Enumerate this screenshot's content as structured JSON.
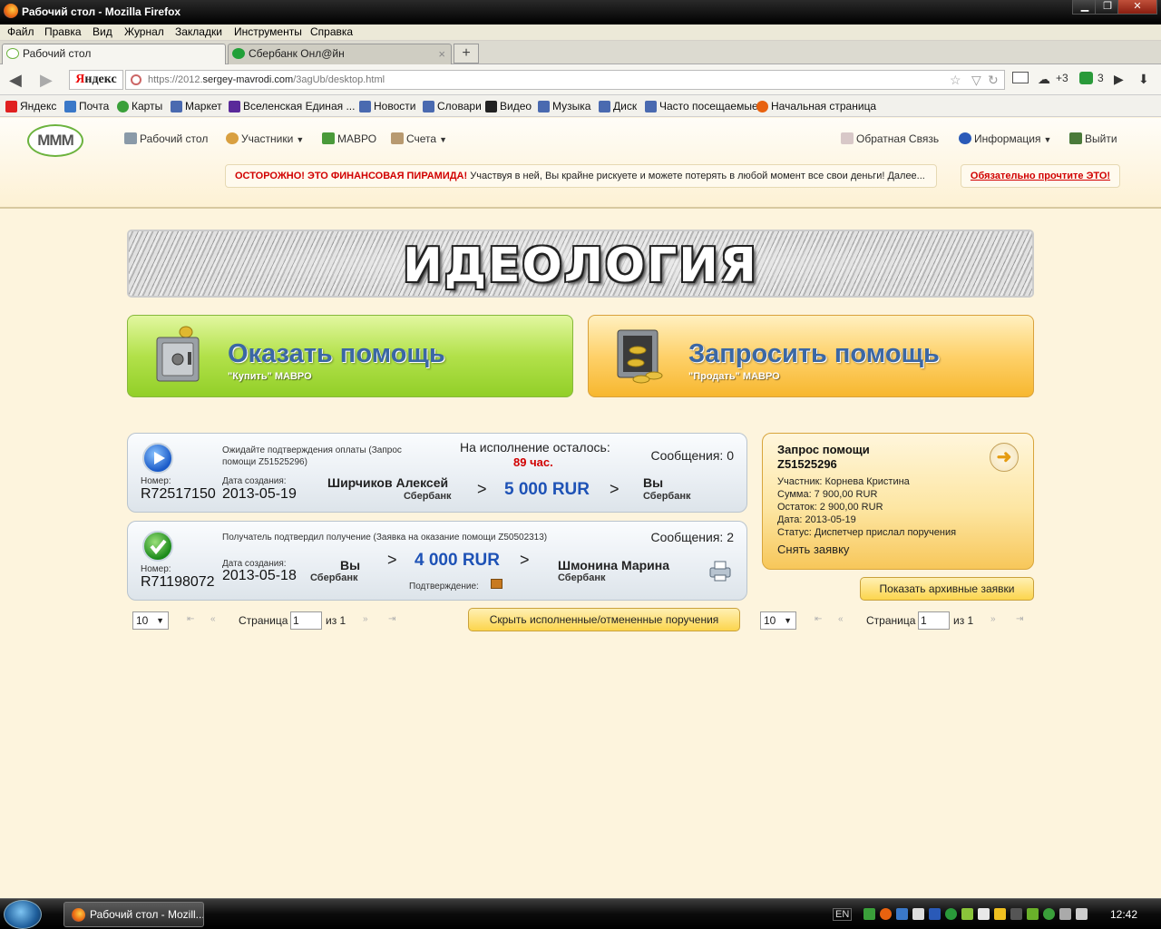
{
  "window": {
    "title": "Рабочий стол - Mozilla Firefox",
    "controls": {
      "minimize": "▁",
      "maximize": "❐",
      "close": "✕"
    }
  },
  "menu": [
    "Файл",
    "Правка",
    "Вид",
    "Журнал",
    "Закладки",
    "Инструменты",
    "Справка"
  ],
  "tabs": [
    {
      "label": "Рабочий стол",
      "active": true
    },
    {
      "label": "Сбербанк Онл@йн",
      "active": false
    }
  ],
  "new_tab": "+",
  "navbar": {
    "back": "◀",
    "forward": "▶",
    "yandex_logo_first": "Я",
    "yandex_logo_rest": "ндекс",
    "url_prefix": "https://2012.",
    "url_domain": "sergey-mavrodi.com",
    "url_path": "/3agUb/desktop.html",
    "star": "☆",
    "dropdown": "▽",
    "reload": "↻",
    "mail_count": "+3",
    "ext_count": "3"
  },
  "bookmarks": [
    {
      "label": "Яндекс",
      "color": "#e02020"
    },
    {
      "label": "Почта",
      "color": "#3a78c8"
    },
    {
      "label": "Карты",
      "color": "#3aa03a"
    },
    {
      "label": "Маркет",
      "color": "#4a6ab0"
    },
    {
      "label": "Вселенская Единая ...",
      "color": "#5a2a9a"
    },
    {
      "label": "Новости",
      "color": "#4a6ab0"
    },
    {
      "label": "Словари",
      "color": "#4a6ab0"
    },
    {
      "label": "Видео",
      "color": "#222222"
    },
    {
      "label": "Музыка",
      "color": "#4a6ab0"
    },
    {
      "label": "Диск",
      "color": "#4a6ab0"
    },
    {
      "label": "Часто посещаемые",
      "color": "#4a6ab0"
    },
    {
      "label": "Начальная страница",
      "color": "#e8620f"
    }
  ],
  "site_nav": {
    "logo": "MMM",
    "desktop": "Рабочий стол",
    "participants": "Участники",
    "mavro": "МАВРО",
    "accounts": "Счета",
    "feedback": "Обратная Связь",
    "info": "Информация",
    "logout": "Выйти"
  },
  "warning": {
    "strong": "ОСТОРОЖНО! ЭТО ФИНАНСОВАЯ ПИРАМИДА!",
    "text": " Участвуя в ней, Вы крайне рискуете и можете потерять в любой момент все свои деньги! Далее...",
    "must_read": "Обязательно прочтите ЭТО!"
  },
  "banner": {
    "title": "ИДЕОЛОГИЯ"
  },
  "actions": {
    "offer": {
      "title": "Оказать помощь",
      "subtitle": "\"Купить\" МАВРО"
    },
    "request": {
      "title": "Запросить помощь",
      "subtitle": "\"Продать\" МАВРО"
    }
  },
  "orders": [
    {
      "status_text": "Ожидайте подтверждения оплаты (Запрос помощи Z51525296)",
      "number_label": "Номер:",
      "number": "R72517150",
      "date_label": "Дата создания:",
      "date": "2013-05-19",
      "from_name": "Ширчиков Алексей",
      "from_bank": "Сбербанк",
      "amount": "5 000 RUR",
      "to_name": "Вы",
      "to_bank": "Сбербанк",
      "deadline_label": "На исполнение осталось:",
      "deadline_value": "89 час.",
      "messages": "Сообщения: 0",
      "arrow": ">"
    },
    {
      "status_text": "Получатель подтвердил получение (Заявка на оказание помощи Z50502313)",
      "number_label": "Номер:",
      "number": "R71198072",
      "date_label": "Дата создания:",
      "date": "2013-05-18",
      "from_name": "Вы",
      "from_bank": "Сбербанк",
      "amount": "4 000 RUR",
      "to_name": "Шмонина Марина",
      "to_bank": "Сбербанк",
      "confirm_label": "Подтверждение:",
      "messages": "Сообщения: 2",
      "arrow": ">"
    }
  ],
  "side_request": {
    "title": "Запрос помощи",
    "id": "Z51525296",
    "participant": "Участник: Корнева Кристина",
    "sum": "Сумма: 7 900,00 RUR",
    "remainder": "Остаток: 2 900,00 RUR",
    "date": "Дата: 2013-05-19",
    "status": "Статус: Диспетчер прислал поручения",
    "cancel": "Снять заявку",
    "arrow": "➜"
  },
  "buttons": {
    "show_archive": "Показать архивные заявки",
    "hide_done": "Скрыть исполненные/отмененные поручения"
  },
  "pager_left": {
    "per_page": "10",
    "page_label": "Страница",
    "page": "1",
    "of": "из 1"
  },
  "pager_right": {
    "per_page": "10",
    "page_label": "Страница",
    "page": "1",
    "of": "из 1"
  },
  "pager_glyphs": {
    "first": "⇤",
    "prev": "«",
    "next": "»",
    "last": "⇥",
    "caret": "▼"
  },
  "taskbar": {
    "item": "Рабочий стол - Mozill...",
    "lang": "EN",
    "clock": "12:42"
  }
}
